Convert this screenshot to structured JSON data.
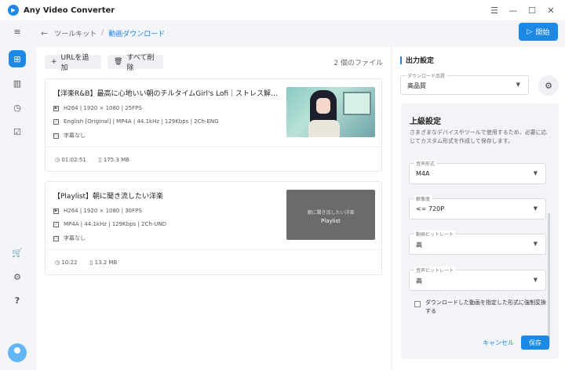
{
  "app": {
    "title": "Any Video Converter",
    "logo_glyph": "▶"
  },
  "window_controls": {
    "menu": "☰",
    "minimize": "—",
    "maximize": "☐",
    "close": "✕"
  },
  "rail": {
    "items": [
      {
        "name": "collapse-menu-icon",
        "glyph": "≡"
      },
      {
        "name": "toolkit-icon",
        "glyph": "⊞"
      },
      {
        "name": "book-icon",
        "glyph": "▥"
      },
      {
        "name": "history-icon",
        "glyph": "◷"
      },
      {
        "name": "tasks-icon",
        "glyph": "☑"
      },
      {
        "name": "cart-icon",
        "glyph": "🛒"
      },
      {
        "name": "settings-icon",
        "glyph": "⚙"
      },
      {
        "name": "help-icon",
        "glyph": "?"
      }
    ]
  },
  "breadcrumb": {
    "back": "←",
    "parent": "ツールキット",
    "separator": "/",
    "current": "動画ダウンロード"
  },
  "start_button": {
    "icon": "▷",
    "label": "開始"
  },
  "toolbar": {
    "add_url": "URLを追加",
    "add_icon": "+",
    "delete_all": "すべて削除",
    "delete_icon": "🗑",
    "file_count": "2 個のファイル"
  },
  "items": [
    {
      "title": "【洋楽R&B】最高に心地いい朝のチルタイムGirl's Lofi｜ストレス解消＆リラッ...",
      "video": "H264 | 1920 × 1080 | 25FPS",
      "audio": "English [Original] | MP4A | 44.1kHz | 129Kbps | 2Ch-ENG",
      "subtitle": "字幕なし",
      "duration": "01:02:51",
      "size": "175.3 MB"
    },
    {
      "title": "【Playlist】朝に聞き流したい洋楽",
      "video": "H264 | 1920 × 1080 | 30FPS",
      "audio": "MP4A | 44.1kHz | 129Kbps | 2Ch-UND",
      "subtitle": "字幕なし",
      "duration": "10:22",
      "size": "13.2 MB",
      "thumb_text": "朝に聞き流したい洋楽",
      "thumb_label": "Playlist"
    }
  ],
  "output": {
    "heading": "出力設定",
    "quality_label": "ダウンロード品質",
    "quality_value": "高品質"
  },
  "advanced": {
    "heading": "上級設定",
    "description": "さまざまなデバイスやツールで使用するため、必要に応じてカスタム形式を作成して保存します。",
    "fields": [
      {
        "label": "音声形式",
        "value": "M4A"
      },
      {
        "label": "解像度",
        "value": "<= 720P"
      },
      {
        "label": "動画ビットレート",
        "value": "高"
      },
      {
        "label": "音声ビットレート",
        "value": "高"
      }
    ],
    "checkbox_label": "ダウンロードした動画を指定した形式に強制変換する",
    "cancel": "キャンセル",
    "save": "保存"
  },
  "colors": {
    "accent": "#1e88e5"
  }
}
